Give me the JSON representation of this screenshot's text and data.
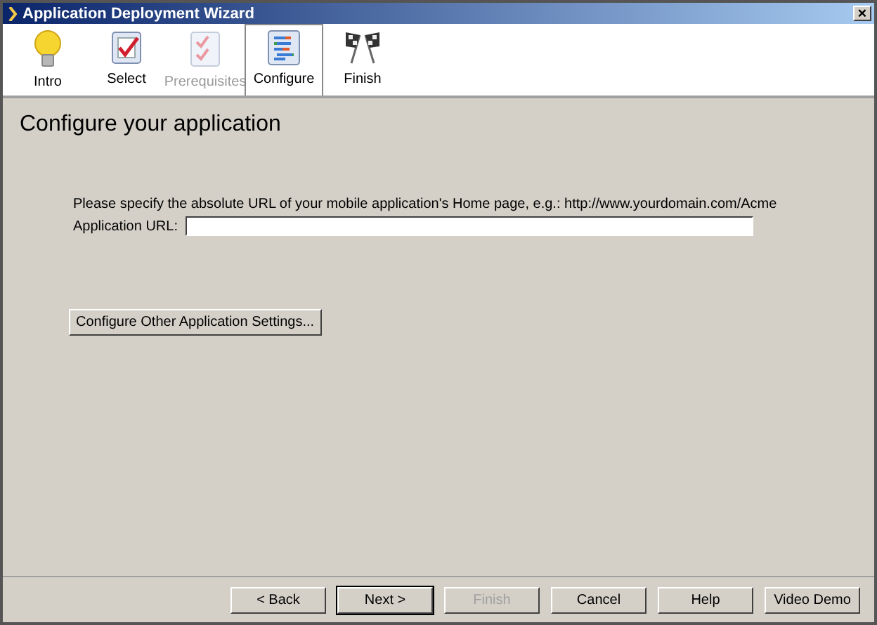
{
  "window": {
    "title": "Application Deployment Wizard",
    "close": "×"
  },
  "steps": [
    {
      "label": "Intro",
      "kind": "bulb",
      "selected": false,
      "disabled": false
    },
    {
      "label": "Select",
      "kind": "check",
      "selected": false,
      "disabled": false
    },
    {
      "label": "Prerequisites",
      "kind": "checklist",
      "selected": false,
      "disabled": true
    },
    {
      "label": "Configure",
      "kind": "configure",
      "selected": true,
      "disabled": false
    },
    {
      "label": "Finish",
      "kind": "flags",
      "selected": false,
      "disabled": false
    }
  ],
  "heading": "Configure your application",
  "instruction": "Please specify the absolute URL of your mobile application's Home page, e.g.: http://www.yourdomain.com/Acme",
  "url_field": {
    "label": "Application URL:"
  },
  "settings_button": "Configure Other Application Settings...",
  "buttons": [
    {
      "label": "< Back",
      "disabled": false,
      "default": false
    },
    {
      "label": "Next >",
      "disabled": false,
      "default": true
    },
    {
      "label": "Finish",
      "disabled": true,
      "default": false
    },
    {
      "label": "Cancel",
      "disabled": false,
      "default": false
    },
    {
      "label": "Help",
      "disabled": false,
      "default": false
    },
    {
      "label": "Video Demo",
      "disabled": false,
      "default": false
    }
  ]
}
